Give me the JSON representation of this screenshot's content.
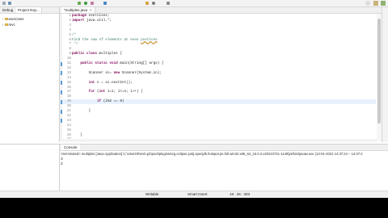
{
  "left_panel": {
    "tabs": [
      "Debug",
      "Project Exp..."
    ],
    "tree": [
      {
        "label": "exercises"
      },
      {
        "label": "mvc"
      }
    ]
  },
  "editor": {
    "tab_label": "*multiples.java",
    "lines": [
      {
        "n": "1",
        "html": "<span class=\"kw\">package</span> exercises;"
      },
      {
        "n": "2",
        "html": "<span class=\"kw\">import</span> java.util.*;"
      },
      {
        "n": "3",
        "html": ""
      },
      {
        "n": "4",
        "html": ""
      },
      {
        "n": "5",
        "html": "<span class=\"cm\">/*</span>"
      },
      {
        "n": "6",
        "html": "<span class=\"cm\">Find the sum of elements at even <span class=\"sq\">postions</span></span>"
      },
      {
        "n": "7",
        "html": "<span class=\"cm\"> */</span>"
      },
      {
        "n": "8",
        "html": ""
      },
      {
        "n": "9",
        "html": "<span class=\"kw\">public class</span> multiples {"
      },
      {
        "n": "10",
        "html": ""
      },
      {
        "n": "11",
        "html": "    <span class=\"kw\">public static void</span> main(String[] args) {"
      },
      {
        "n": "12",
        "html": ""
      },
      {
        "n": "13",
        "html": "        Scanner sc= <span class=\"kw\">new</span> Scanner(System.in);"
      },
      {
        "n": "14",
        "html": ""
      },
      {
        "n": "15",
        "html": "        <span class=\"kw\">int</span> n = sc.nextInt();"
      },
      {
        "n": "16",
        "html": ""
      },
      {
        "n": "17",
        "html": "        <span class=\"kw\">for</span> (<span class=\"kw\">int</span> i=1; i<=n; i++) {"
      },
      {
        "n": "18",
        "html": ""
      },
      {
        "n": "19",
        "html": "            <span class=\"kw\">if</span> (i%2 == 0)"
      },
      {
        "n": "20",
        "html": ""
      },
      {
        "n": "21",
        "html": "        }"
      },
      {
        "n": "22",
        "html": ""
      },
      {
        "n": "23",
        "html": ""
      },
      {
        "n": "24",
        "html": ""
      },
      {
        "n": "25",
        "html": ""
      },
      {
        "n": "26",
        "html": "    }"
      },
      {
        "n": "27",
        "html": ""
      }
    ],
    "current_line": 19
  },
  "console": {
    "tab_label": "Console",
    "terminated": "<terminated> multiples [Java Application] C:\\Users\\Rons\\.p2\\pool\\plugins\\org.eclipse.justj.openjdk.hotspot.jre.full.win32.x86_64_16.0.2.v20210721-1149\\jre\\bin\\javaw.exe  (13-01-2022 14:37:24 – 14:37:2",
    "output": [
      "3",
      "2"
    ]
  },
  "status": {
    "mode": "Writable",
    "insert": "Smart Insert",
    "position": "19 : 26 : 303"
  },
  "colors": {
    "keyword": "#7f0055",
    "comment": "#3f7f5f",
    "current_line": "#e8f2fe"
  }
}
